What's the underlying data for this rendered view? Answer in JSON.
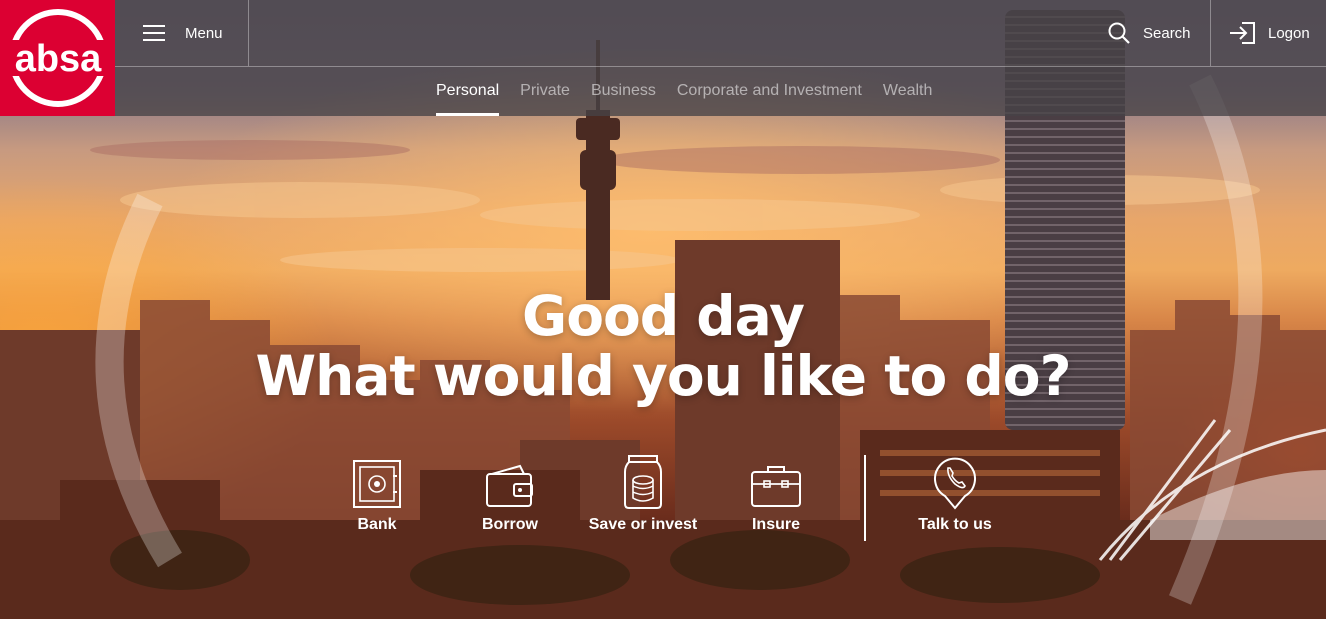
{
  "brand": {
    "logo_text": "absa",
    "brand_color": "#dc0032"
  },
  "header": {
    "menu_label": "Menu",
    "search_label": "Search",
    "logon_label": "Logon",
    "segments": [
      {
        "label": "Personal",
        "active": true
      },
      {
        "label": "Private",
        "active": false
      },
      {
        "label": "Business",
        "active": false
      },
      {
        "label": "Corporate and Investment",
        "active": false
      },
      {
        "label": "Wealth",
        "active": false
      }
    ]
  },
  "hero": {
    "greeting": "Good day",
    "question": "What would you like to do?"
  },
  "actions": [
    {
      "label": "Bank",
      "icon": "safe-icon"
    },
    {
      "label": "Borrow",
      "icon": "wallet-icon"
    },
    {
      "label": "Save or invest",
      "icon": "coin-jar-icon"
    },
    {
      "label": "Insure",
      "icon": "briefcase-icon"
    },
    {
      "label": "Talk to us",
      "icon": "phone-pin-icon"
    }
  ]
}
